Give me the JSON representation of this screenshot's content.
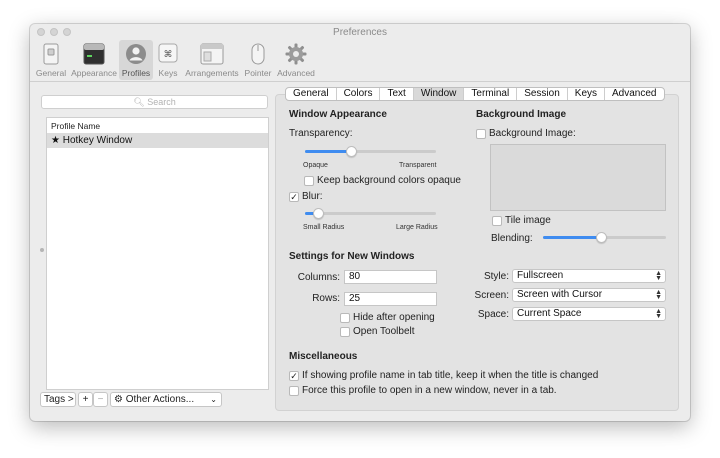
{
  "window": {
    "title": "Preferences"
  },
  "toolbar": {
    "items": [
      {
        "label": "General",
        "icon": "switch-icon"
      },
      {
        "label": "Appearance",
        "icon": "window-icon"
      },
      {
        "label": "Profiles",
        "icon": "person-icon",
        "selected": true
      },
      {
        "label": "Keys",
        "icon": "command-key-icon"
      },
      {
        "label": "Arrangements",
        "icon": "arrangements-icon"
      },
      {
        "label": "Pointer",
        "icon": "mouse-icon"
      },
      {
        "label": "Advanced",
        "icon": "gear-icon"
      }
    ]
  },
  "left": {
    "search_placeholder": "Search",
    "list_header": "Profile Name",
    "profiles": [
      "★ Hotkey Window"
    ],
    "tags_button": "Tags >",
    "add_button": "+",
    "remove_button": "−",
    "other_actions": "Other Actions..."
  },
  "tabs": [
    "General",
    "Colors",
    "Text",
    "Window",
    "Terminal",
    "Session",
    "Keys",
    "Advanced"
  ],
  "active_tab": "Window",
  "window_appearance": {
    "heading": "Window Appearance",
    "transparency_label": "Transparency:",
    "transparency_min": "Opaque",
    "transparency_max": "Transparent",
    "transparency_value": 0.35,
    "keep_bg_opaque": {
      "label": "Keep background colors opaque",
      "checked": false
    },
    "blur": {
      "label": "Blur:",
      "checked": true
    },
    "blur_min": "Small Radius",
    "blur_max": "Large Radius",
    "blur_value": 0.1
  },
  "background_image": {
    "heading": "Background Image",
    "checkbox": {
      "label": "Background Image:",
      "checked": false
    },
    "tile": {
      "label": "Tile image",
      "checked": false
    },
    "blending_label": "Blending:",
    "blending_value": 0.47
  },
  "new_windows": {
    "heading": "Settings for New Windows",
    "columns_label": "Columns:",
    "columns_value": "80",
    "rows_label": "Rows:",
    "rows_value": "25",
    "hide_after_opening": {
      "label": "Hide after opening",
      "checked": false
    },
    "open_toolbelt": {
      "label": "Open Toolbelt",
      "checked": false
    },
    "style_label": "Style:",
    "style_value": "Fullscreen",
    "screen_label": "Screen:",
    "screen_value": "Screen with Cursor",
    "space_label": "Space:",
    "space_value": "Current Space"
  },
  "misc": {
    "heading": "Miscellaneous",
    "keep_profile_name": {
      "label": "If showing profile name in tab title, keep it when the title is changed",
      "checked": true
    },
    "force_new_window": {
      "label": "Force this profile to open in a new window, never in a tab.",
      "checked": false
    }
  },
  "colors": {
    "accent": "#3f8cf0",
    "window_bg": "#ececec",
    "panel_bg": "#e3e3e3"
  }
}
